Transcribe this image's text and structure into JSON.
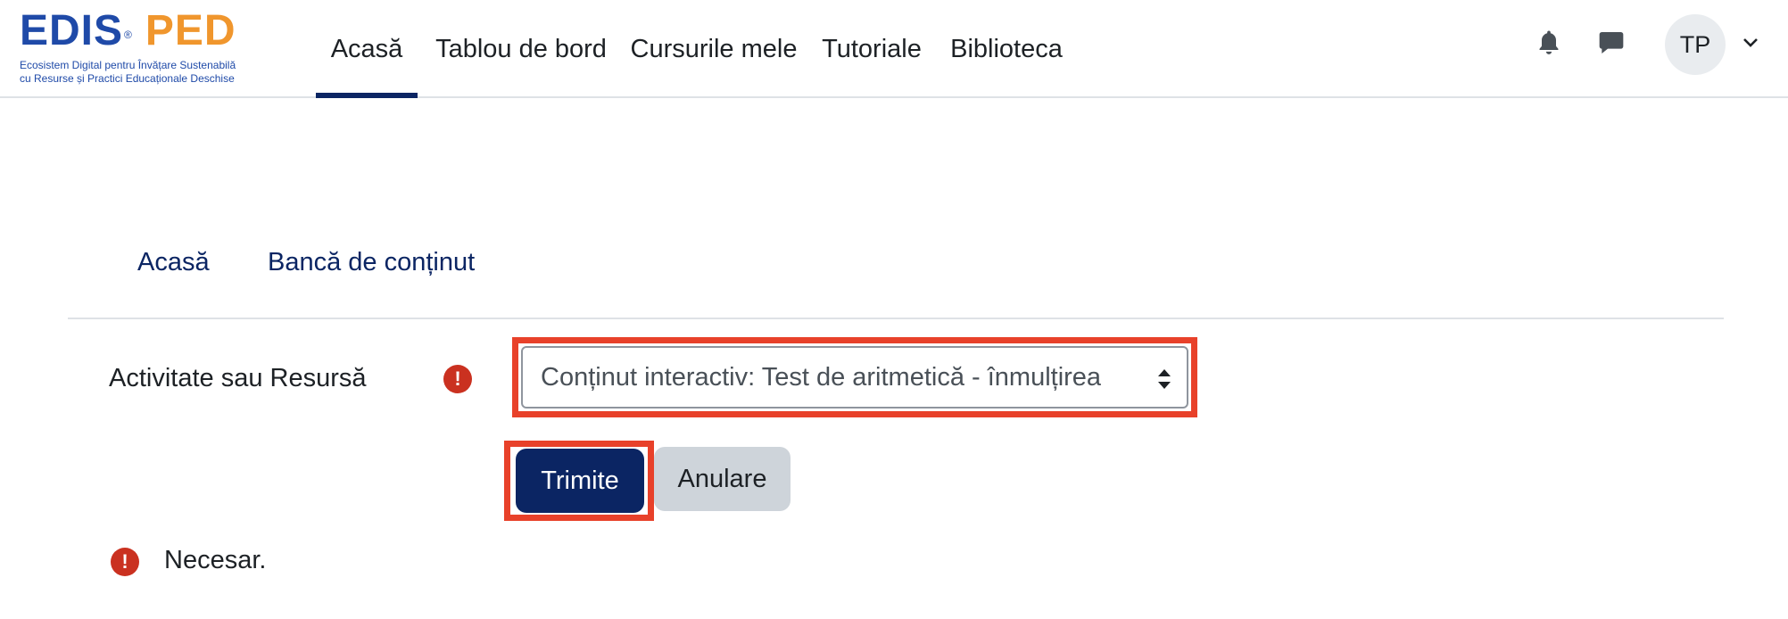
{
  "logo": {
    "brand_part1": "EDIS",
    "brand_reg": "®",
    "brand_part2": "PED",
    "tagline_line1": "Ecosistem Digital pentru Învățare Sustenabilă",
    "tagline_line2": "cu Resurse și Practici Educaționale Deschise"
  },
  "nav": {
    "items": [
      {
        "label": "Acasă",
        "active": true
      },
      {
        "label": "Tablou de bord"
      },
      {
        "label": "Cursurile mele"
      },
      {
        "label": "Tutoriale"
      },
      {
        "label": "Biblioteca"
      }
    ]
  },
  "user": {
    "initials": "TP",
    "icons": [
      "bell-icon",
      "message-icon",
      "chevron-down-icon"
    ]
  },
  "secondary_nav": {
    "items": [
      "Acasă",
      "Bancă de conținut"
    ]
  },
  "form": {
    "field_label": "Activitate sau Resursă",
    "required_icon_glyph": "!",
    "select_value": "Conținut interactiv: Test de aritmetică - înmulțirea",
    "submit_label": "Trimite",
    "cancel_label": "Anulare"
  },
  "note": {
    "text": "Necesar."
  },
  "colors": {
    "primary": "#0b2563",
    "highlight": "#e8412a",
    "required": "#ca3120",
    "secondary_button": "#ced4da"
  }
}
